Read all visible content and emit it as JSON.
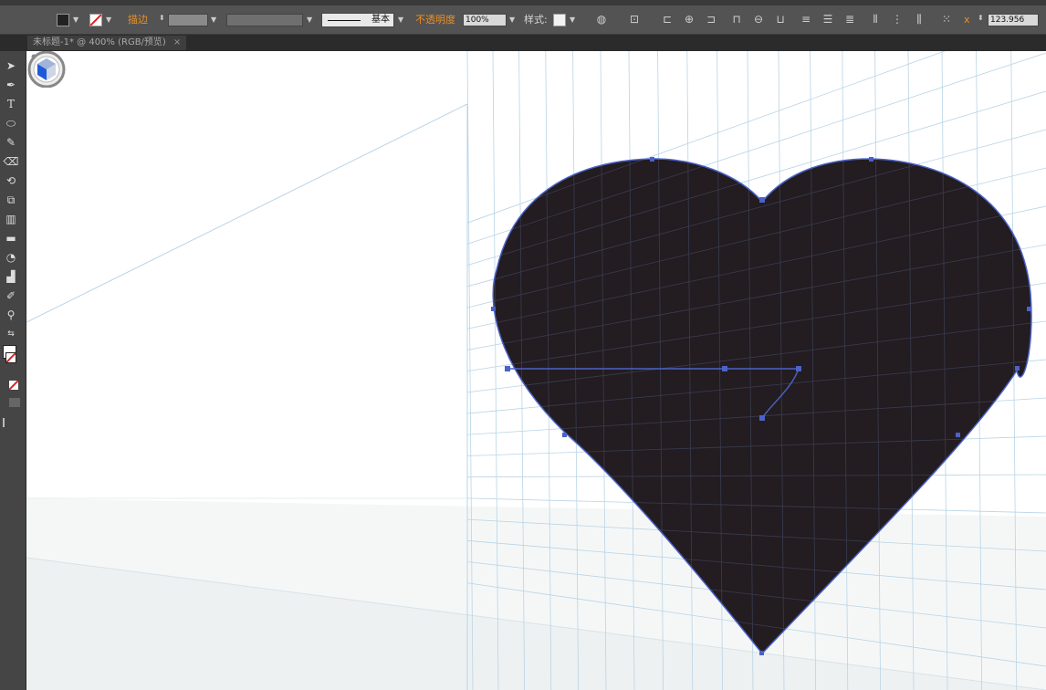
{
  "control_bar": {
    "stroke_label": "描边",
    "stroke_profile_label": "基本",
    "opacity_label": "不透明度",
    "opacity_value": "100%",
    "style_label": "样式:",
    "dimension_value": "123.956"
  },
  "document": {
    "tab_title": "未标题-1* @ 400% (RGB/预览)",
    "close_glyph": "×"
  },
  "tools": [
    {
      "name": "selection-tool",
      "icon": "arrow-icon"
    },
    {
      "name": "pen-tool",
      "icon": "pen-icon"
    },
    {
      "name": "type-tool",
      "icon": "type-icon"
    },
    {
      "name": "ellipse-tool",
      "icon": "ellipse-icon"
    },
    {
      "name": "pencil-tool",
      "icon": "pencil-icon"
    },
    {
      "name": "eraser-tool",
      "icon": "eraser-icon"
    },
    {
      "name": "rotate-tool",
      "icon": "rotate-icon"
    },
    {
      "name": "free-transform-tool",
      "icon": "transform-icon"
    },
    {
      "name": "graph-tool",
      "icon": "graph-icon"
    },
    {
      "name": "gradient-tool",
      "icon": "gradient-icon"
    },
    {
      "name": "blend-tool",
      "icon": "blend-icon"
    },
    {
      "name": "column-graph-tool",
      "icon": "column-icon"
    },
    {
      "name": "eyedropper-tool",
      "icon": "eyedropper-icon"
    },
    {
      "name": "zoom-tool",
      "icon": "zoom-icon"
    }
  ],
  "colors": {
    "accent_orange": "#e8902a",
    "path_blue": "#4a63c8",
    "heart_fill": "#231c20",
    "grid_line": "#b9d4e6"
  }
}
